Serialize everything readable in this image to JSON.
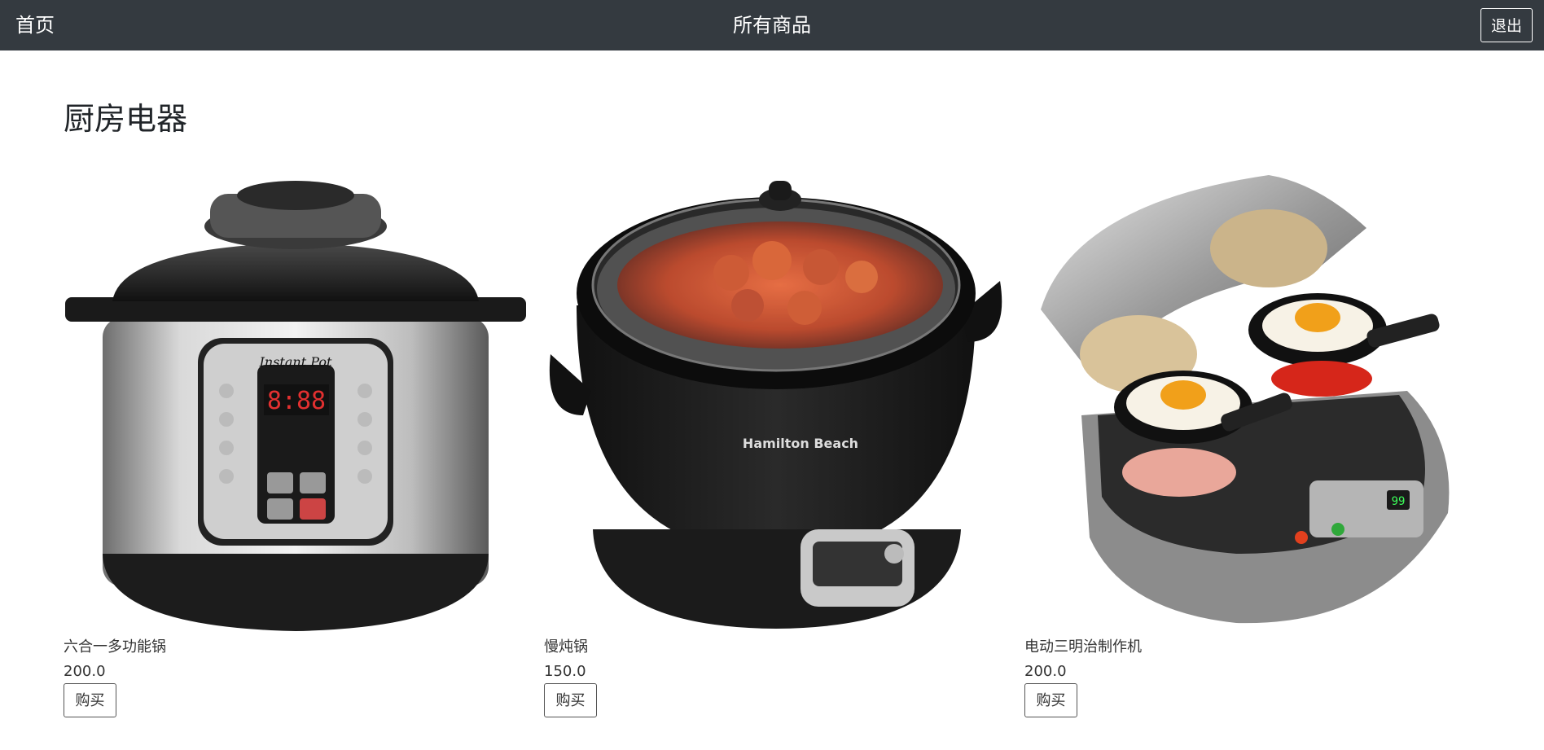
{
  "nav": {
    "home_label": "首页",
    "title": "所有商品",
    "logout_label": "退出"
  },
  "category": {
    "title": "厨房电器"
  },
  "products": [
    {
      "name": "六合一多功能锅",
      "price": "200.0",
      "buy_label": "购买",
      "image_icon": "pressure-cooker-image",
      "brand_text": "Instant Pot"
    },
    {
      "name": "慢炖锅",
      "price": "150.0",
      "buy_label": "购买",
      "image_icon": "slow-cooker-image",
      "brand_text": "Hamilton Beach"
    },
    {
      "name": "电动三明治制作机",
      "price": "200.0",
      "buy_label": "购买",
      "image_icon": "sandwich-maker-image"
    }
  ],
  "colors": {
    "navbar_bg": "#343a40",
    "page_bg": "#ffffff"
  }
}
